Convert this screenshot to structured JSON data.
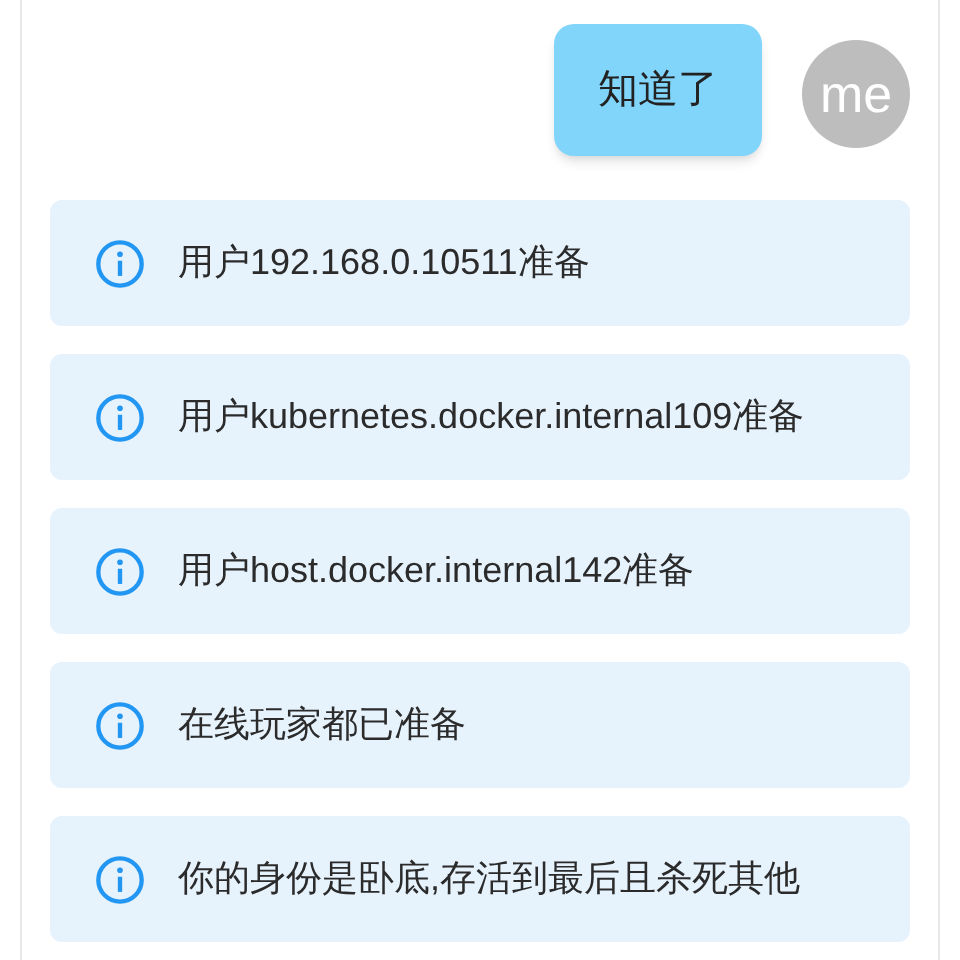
{
  "messages": [
    {
      "text": "知道了",
      "avatar": "me"
    }
  ],
  "notices": [
    {
      "text": "用户192.168.0.10511准备"
    },
    {
      "text": "用户kubernetes.docker.internal109准备"
    },
    {
      "text": "用户host.docker.internal142准备"
    },
    {
      "text": "在线玩家都已准备"
    },
    {
      "text": "你的身份是卧底,存活到最后且杀死其他"
    }
  ]
}
